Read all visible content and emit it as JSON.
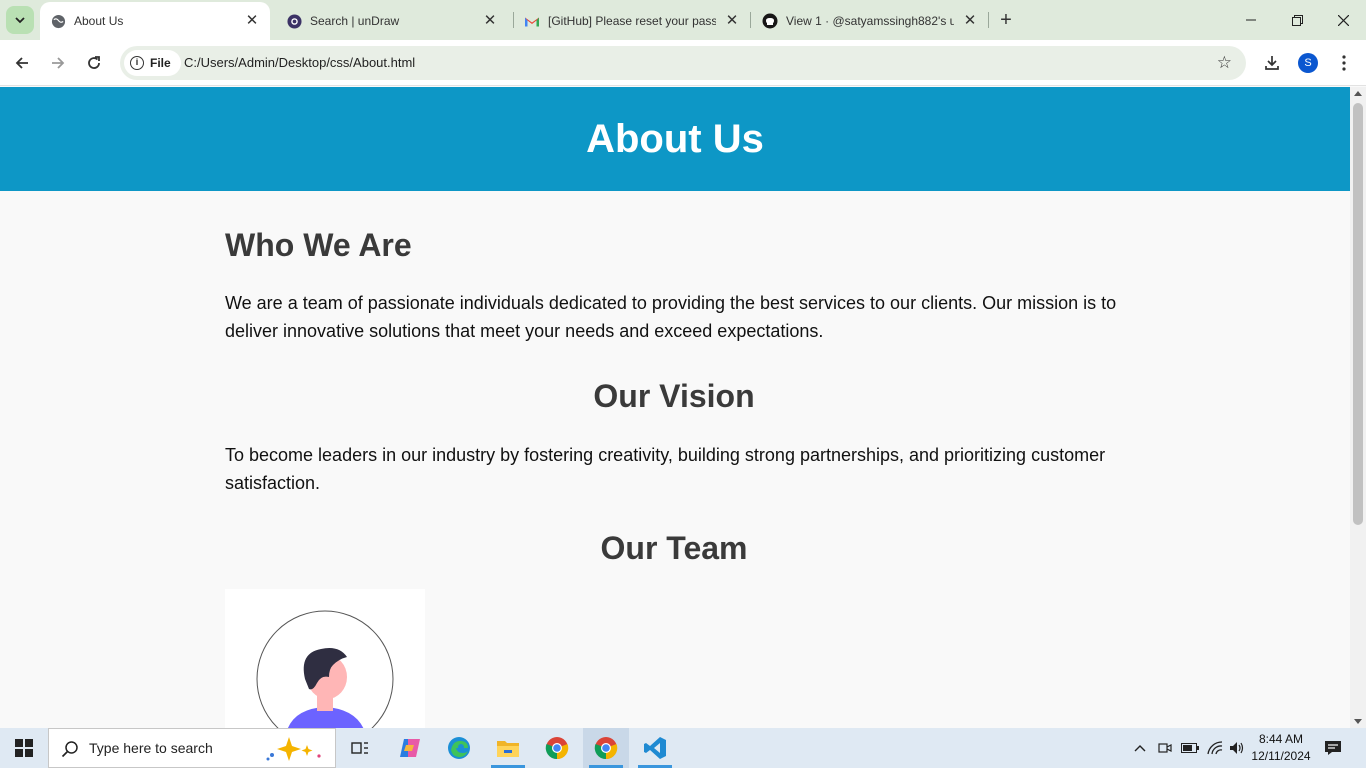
{
  "browser": {
    "tabs": [
      {
        "title": "About Us",
        "active": true,
        "icon": "globe-icon"
      },
      {
        "title": "Search | unDraw",
        "active": false,
        "icon": "undraw-icon"
      },
      {
        "title": "[GitHub] Please reset your pass",
        "active": false,
        "icon": "gmail-icon"
      },
      {
        "title": "View 1 · @satyamssingh882's u",
        "active": false,
        "icon": "github-icon"
      }
    ],
    "chip_label": "File",
    "url": "C:/Users/Admin/Desktop/css/About.html",
    "profile_initial": "S"
  },
  "page": {
    "header_title": "About Us",
    "who_heading": "Who We Are",
    "who_text": "We are a team of passionate individuals dedicated to providing the best services to our clients. Our mission is to deliver innovative solutions that meet your needs and exceed expectations.",
    "vision_heading": "Our Vision",
    "vision_text": "To become leaders in our industry by fostering creativity, building strong partnerships, and prioritizing customer satisfaction.",
    "team_heading": "Our Team",
    "colors": {
      "header_bg": "#0d97c6",
      "heading": "#3a3a3a"
    }
  },
  "taskbar": {
    "search_placeholder": "Type here to search",
    "time": "8:44 AM",
    "date": "12/11/2024"
  }
}
